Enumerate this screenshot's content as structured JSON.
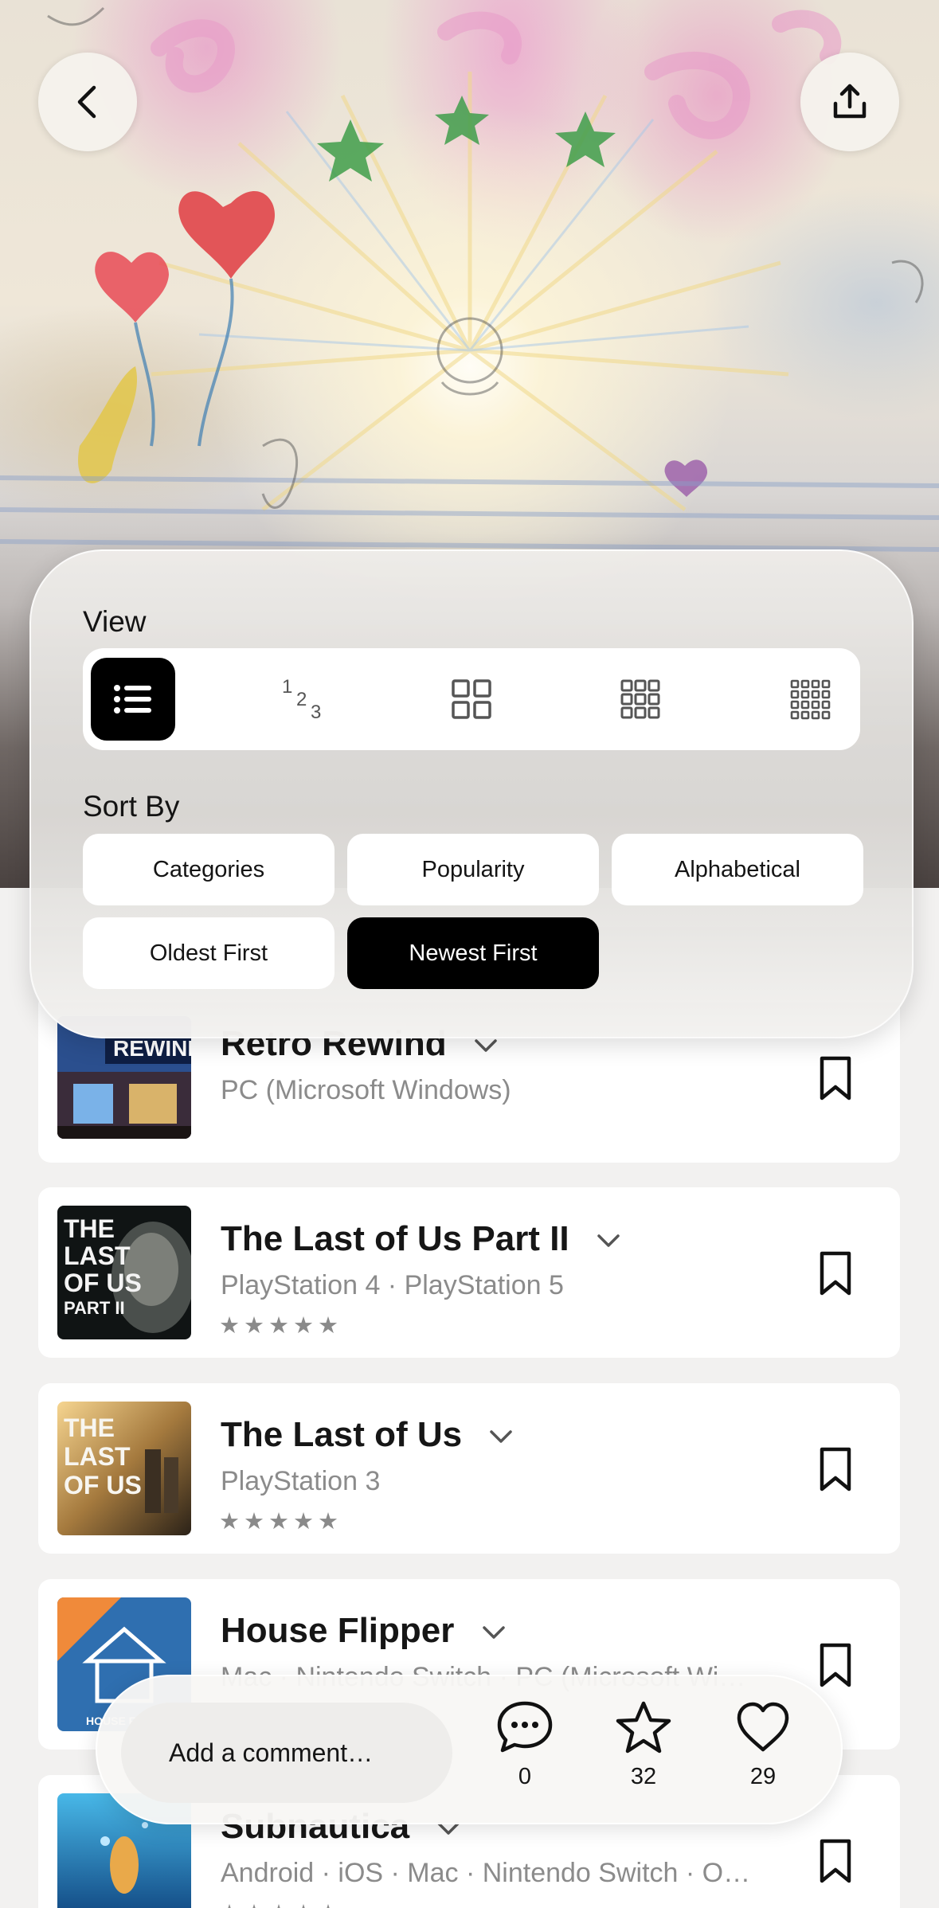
{
  "nav": {
    "back_icon": "chevron-left-icon",
    "share_icon": "share-upload-icon"
  },
  "view_panel": {
    "view_label": "View",
    "view_options": [
      {
        "name": "list",
        "icon": "list-icon",
        "active": true
      },
      {
        "name": "ranked",
        "icon": "ranked-numbers-icon",
        "glyphs": [
          "1",
          "2",
          "3"
        ],
        "active": false
      },
      {
        "name": "grid-2",
        "icon": "grid-2x2-icon",
        "active": false
      },
      {
        "name": "grid-3",
        "icon": "grid-3x3-icon",
        "active": false
      },
      {
        "name": "grid-4",
        "icon": "grid-4x4-icon",
        "active": false
      }
    ],
    "sort_label": "Sort By",
    "sort_options": [
      {
        "label": "Categories",
        "active": false
      },
      {
        "label": "Popularity",
        "active": false
      },
      {
        "label": "Alphabetical",
        "active": false
      },
      {
        "label": "Oldest First",
        "active": false
      },
      {
        "label": "Newest First",
        "active": true
      }
    ]
  },
  "games": [
    {
      "title": "Retro Rewind",
      "platforms": "PC (Microsoft Windows)",
      "rating_stars": "",
      "cover_text": "REWIND"
    },
    {
      "title": "The Last of Us Part II",
      "platforms": "PlayStation 4 · PlayStation 5",
      "rating_stars": "★★★★★",
      "cover_text": "THE LAST OF US PART II"
    },
    {
      "title": "The Last of Us",
      "platforms": "PlayStation 3",
      "rating_stars": "★★★★★",
      "cover_text": "THE LAST OF US"
    },
    {
      "title": "House Flipper",
      "platforms": "Mac · Nintendo Switch · PC (Microsoft Wi…",
      "rating_stars": "",
      "cover_text": "HOUSE FLIPPER"
    },
    {
      "title": "Subnautica",
      "platforms": "Android · iOS · Mac · Nintendo Switch · O…",
      "rating_stars": "★★★★★",
      "cover_text": ""
    }
  ],
  "comment_bar": {
    "placeholder": "Add a comment…",
    "comments_count": "0",
    "stars_count": "32",
    "likes_count": "29"
  },
  "colors": {
    "accent": "#000000",
    "background": "#f2f1f0",
    "muted_text": "#8b8b8b"
  }
}
